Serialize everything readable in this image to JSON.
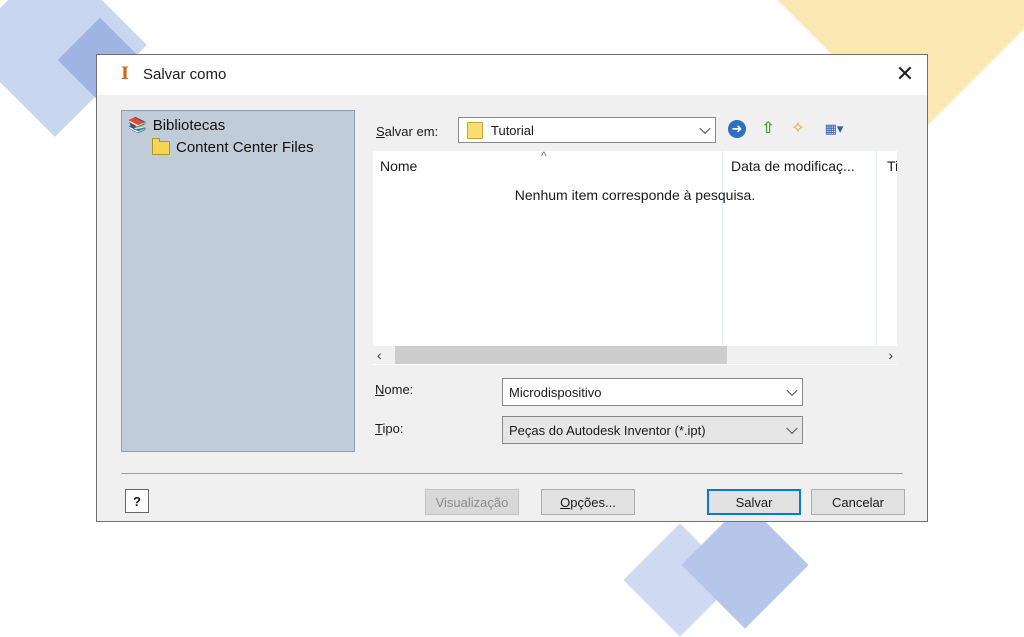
{
  "dialog": {
    "title": "Salvar como",
    "close_glyph": "✕"
  },
  "libraries": {
    "root_label": "Bibliotecas",
    "root_icon": "library-icon",
    "items": [
      {
        "label": "Content Center Files",
        "icon": "folder-icon"
      }
    ]
  },
  "location": {
    "label_accel": "S",
    "label_rest": "alvar em:",
    "value": "Tutorial"
  },
  "toolbar": {
    "back_icon": "back-arrow-icon",
    "up_icon": "up-folder-icon",
    "new_folder_icon": "new-folder-icon",
    "views_icon": "views-menu-icon"
  },
  "file_list": {
    "columns": [
      "Nome",
      "Data de modificaç...",
      "Ti"
    ],
    "sort_glyph": "^",
    "empty_message": "Nenhum item corresponde à pesquisa."
  },
  "fields": {
    "name_label_accel": "N",
    "name_label_rest": "ome:",
    "name_value": "Microdispositivo",
    "type_label_accel": "T",
    "type_label_rest": "ipo:",
    "type_value": "Peças do Autodesk Inventor (*.ipt)"
  },
  "buttons": {
    "help": "?",
    "preview": "Visualização",
    "options_accel": "O",
    "options_rest": "pções...",
    "save": "Salvar",
    "cancel": "Cancelar"
  },
  "colors": {
    "left_pane": "#c0cdd9",
    "dialog_bg": "#f0f0f0",
    "default_button_border": "#0a78d7"
  }
}
